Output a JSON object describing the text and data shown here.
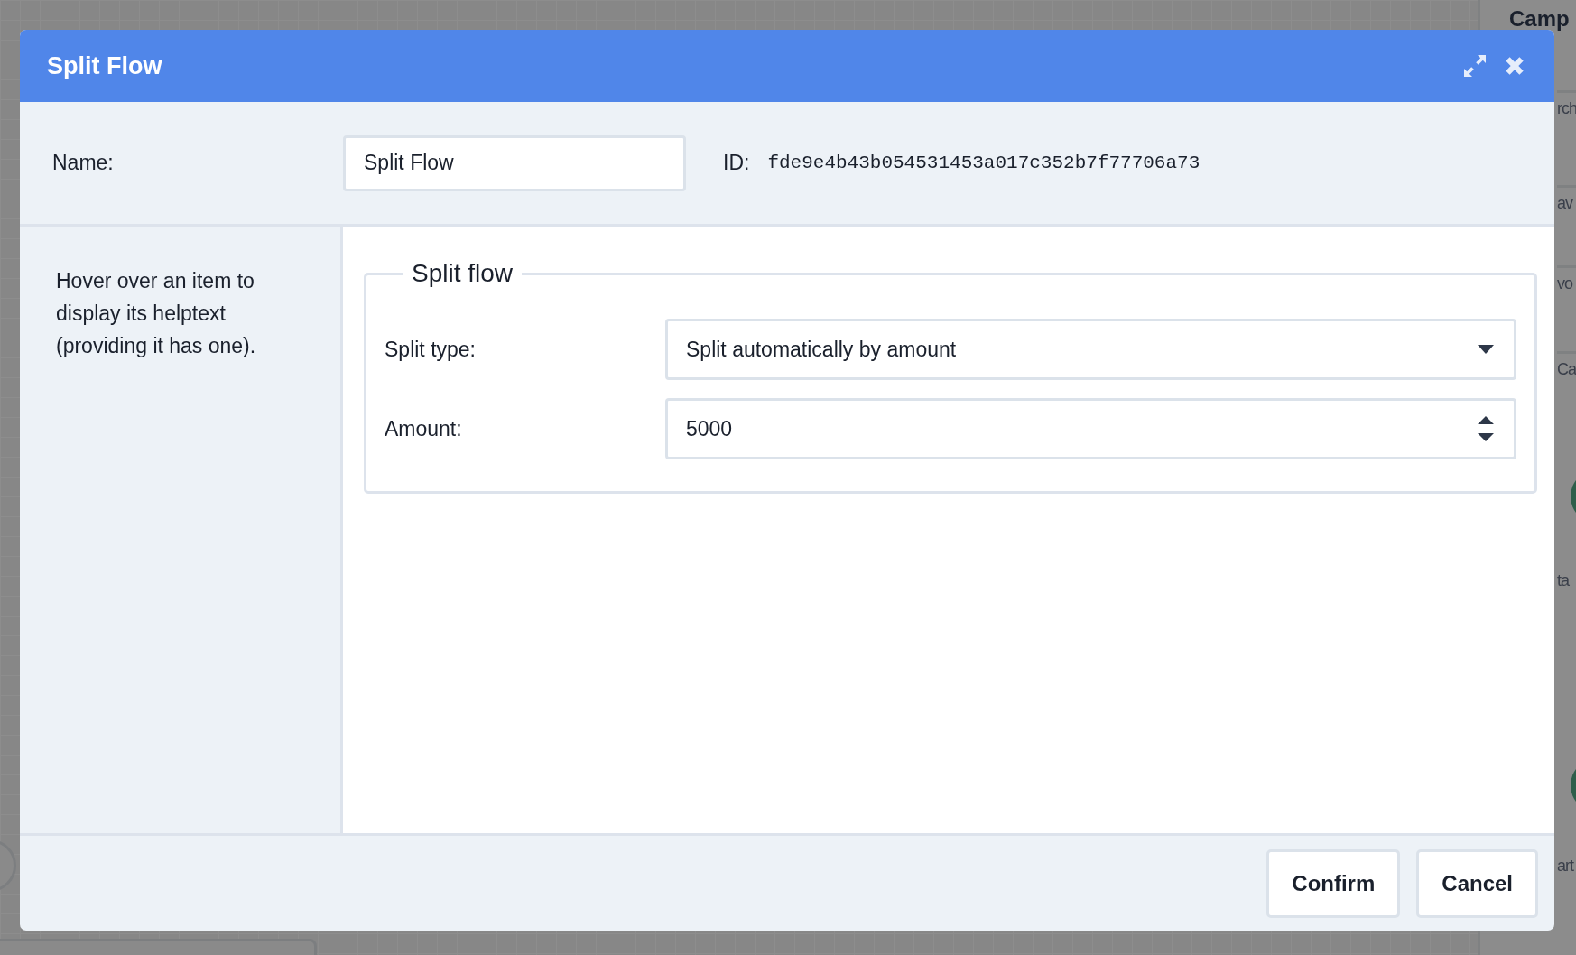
{
  "background": {
    "panel_title": "Camp",
    "fragments": [
      "rch",
      "av",
      "vo",
      "Ca",
      "ta",
      "art"
    ]
  },
  "dialog": {
    "title": "Split Flow",
    "name_label": "Name:",
    "name_value": "Split Flow",
    "id_label": "ID:",
    "id_value": "fde9e4b43b054531453a017c352b7f77706a73",
    "helptext": "Hover over an item to display its helptext (providing it has one).",
    "fieldset": {
      "legend": "Split flow",
      "fields": [
        {
          "kind": "select",
          "label": "Split type:",
          "value": "Split automatically by amount"
        },
        {
          "kind": "number",
          "label": "Amount:",
          "value": "5000"
        }
      ]
    },
    "buttons": [
      "Confirm",
      "Cancel"
    ]
  }
}
